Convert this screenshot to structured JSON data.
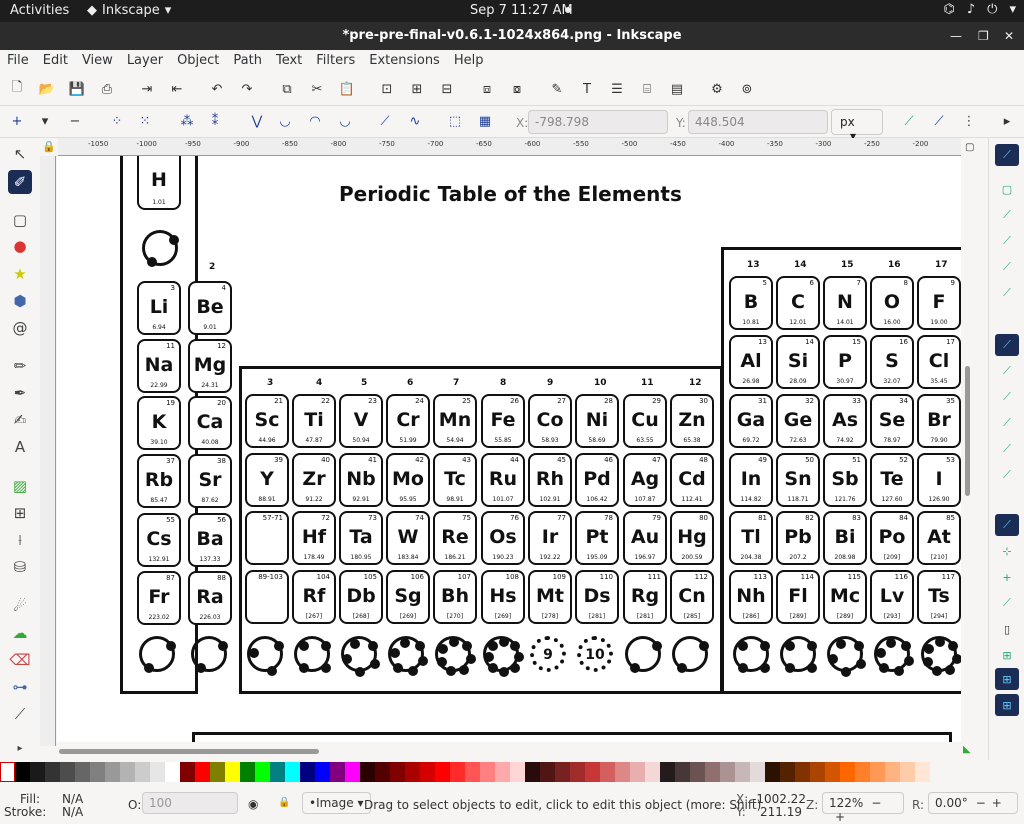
{
  "gnome": {
    "activities": "Activities",
    "app_name": "Inkscape",
    "clock": "Sep 7  11:27 AM"
  },
  "window": {
    "title": "*pre-pre-final-v0.6.1-1024x864.png - Inkscape"
  },
  "menu": [
    "File",
    "Edit",
    "View",
    "Layer",
    "Object",
    "Path",
    "Text",
    "Filters",
    "Extensions",
    "Help"
  ],
  "controls": {
    "x_label": "X:",
    "x_value": "-798.798",
    "y_label": "Y:",
    "y_value": "448.504",
    "unit": "px"
  },
  "ruler_ticks": [
    "-1050",
    "-1000",
    "-950",
    "-900",
    "-850",
    "-800",
    "-750",
    "-700",
    "-650",
    "-600",
    "-550",
    "-500",
    "-450",
    "-400",
    "-350",
    "-300",
    "-250",
    "-200"
  ],
  "canvas": {
    "title": "Periodic Table of the Elements",
    "group_numbers": [
      "2",
      "3",
      "4",
      "5",
      "6",
      "7",
      "8",
      "9",
      "10",
      "11",
      "12",
      "13",
      "14",
      "15",
      "16",
      "17"
    ],
    "ring_labels": [
      "9",
      "10"
    ],
    "elements": [
      {
        "s": "H",
        "n": "",
        "m": "1.01"
      },
      {
        "s": "Li",
        "n": "3",
        "m": "6.94"
      },
      {
        "s": "Be",
        "n": "4",
        "m": "9.01"
      },
      {
        "s": "Na",
        "n": "11",
        "m": "22.99"
      },
      {
        "s": "Mg",
        "n": "12",
        "m": "24.31"
      },
      {
        "s": "K",
        "n": "19",
        "m": "39.10"
      },
      {
        "s": "Ca",
        "n": "20",
        "m": "40.08"
      },
      {
        "s": "Rb",
        "n": "37",
        "m": "85.47"
      },
      {
        "s": "Sr",
        "n": "38",
        "m": "87.62"
      },
      {
        "s": "Cs",
        "n": "55",
        "m": "132.91"
      },
      {
        "s": "Ba",
        "n": "56",
        "m": "137.33"
      },
      {
        "s": "Fr",
        "n": "87",
        "m": "223.02"
      },
      {
        "s": "Ra",
        "n": "88",
        "m": "226.03"
      },
      {
        "s": "Sc",
        "n": "21",
        "m": "44.96"
      },
      {
        "s": "Ti",
        "n": "22",
        "m": "47.87"
      },
      {
        "s": "V",
        "n": "23",
        "m": "50.94"
      },
      {
        "s": "Cr",
        "n": "24",
        "m": "51.99"
      },
      {
        "s": "Mn",
        "n": "25",
        "m": "54.94"
      },
      {
        "s": "Fe",
        "n": "26",
        "m": "55.85"
      },
      {
        "s": "Co",
        "n": "27",
        "m": "58.93"
      },
      {
        "s": "Ni",
        "n": "28",
        "m": "58.69"
      },
      {
        "s": "Cu",
        "n": "29",
        "m": "63.55"
      },
      {
        "s": "Zn",
        "n": "30",
        "m": "65.38"
      },
      {
        "s": "Y",
        "n": "39",
        "m": "88.91"
      },
      {
        "s": "Zr",
        "n": "40",
        "m": "91.22"
      },
      {
        "s": "Nb",
        "n": "41",
        "m": "92.91"
      },
      {
        "s": "Mo",
        "n": "42",
        "m": "95.95"
      },
      {
        "s": "Tc",
        "n": "43",
        "m": "98.91"
      },
      {
        "s": "Ru",
        "n": "44",
        "m": "101.07"
      },
      {
        "s": "Rh",
        "n": "45",
        "m": "102.91"
      },
      {
        "s": "Pd",
        "n": "46",
        "m": "106.42"
      },
      {
        "s": "Ag",
        "n": "47",
        "m": "107.87"
      },
      {
        "s": "Cd",
        "n": "48",
        "m": "112.41"
      },
      {
        "s": "",
        "n": "57-71",
        "m": ""
      },
      {
        "s": "Hf",
        "n": "72",
        "m": "178.49"
      },
      {
        "s": "Ta",
        "n": "73",
        "m": "180.95"
      },
      {
        "s": "W",
        "n": "74",
        "m": "183.84"
      },
      {
        "s": "Re",
        "n": "75",
        "m": "186.21"
      },
      {
        "s": "Os",
        "n": "76",
        "m": "190.23"
      },
      {
        "s": "Ir",
        "n": "77",
        "m": "192.22"
      },
      {
        "s": "Pt",
        "n": "78",
        "m": "195.09"
      },
      {
        "s": "Au",
        "n": "79",
        "m": "196.97"
      },
      {
        "s": "Hg",
        "n": "80",
        "m": "200.59"
      },
      {
        "s": "",
        "n": "89-103",
        "m": ""
      },
      {
        "s": "Rf",
        "n": "104",
        "m": "[267]"
      },
      {
        "s": "Db",
        "n": "105",
        "m": "[268]"
      },
      {
        "s": "Sg",
        "n": "106",
        "m": "[269]"
      },
      {
        "s": "Bh",
        "n": "107",
        "m": "[270]"
      },
      {
        "s": "Hs",
        "n": "108",
        "m": "[269]"
      },
      {
        "s": "Mt",
        "n": "109",
        "m": "[278]"
      },
      {
        "s": "Ds",
        "n": "110",
        "m": "[281]"
      },
      {
        "s": "Rg",
        "n": "111",
        "m": "[281]"
      },
      {
        "s": "Cn",
        "n": "112",
        "m": "[285]"
      },
      {
        "s": "B",
        "n": "5",
        "m": "10.81"
      },
      {
        "s": "C",
        "n": "6",
        "m": "12.01"
      },
      {
        "s": "N",
        "n": "7",
        "m": "14.01"
      },
      {
        "s": "O",
        "n": "8",
        "m": "16.00"
      },
      {
        "s": "F",
        "n": "9",
        "m": "19.00"
      },
      {
        "s": "Al",
        "n": "13",
        "m": "26.98"
      },
      {
        "s": "Si",
        "n": "14",
        "m": "28.09"
      },
      {
        "s": "P",
        "n": "15",
        "m": "30.97"
      },
      {
        "s": "S",
        "n": "16",
        "m": "32.07"
      },
      {
        "s": "Cl",
        "n": "17",
        "m": "35.45"
      },
      {
        "s": "Ga",
        "n": "31",
        "m": "69.72"
      },
      {
        "s": "Ge",
        "n": "32",
        "m": "72.63"
      },
      {
        "s": "As",
        "n": "33",
        "m": "74.92"
      },
      {
        "s": "Se",
        "n": "34",
        "m": "78.97"
      },
      {
        "s": "Br",
        "n": "35",
        "m": "79.90"
      },
      {
        "s": "In",
        "n": "49",
        "m": "114.82"
      },
      {
        "s": "Sn",
        "n": "50",
        "m": "118.71"
      },
      {
        "s": "Sb",
        "n": "51",
        "m": "121.76"
      },
      {
        "s": "Te",
        "n": "52",
        "m": "127.60"
      },
      {
        "s": "I",
        "n": "53",
        "m": "126.90"
      },
      {
        "s": "Tl",
        "n": "81",
        "m": "204.38"
      },
      {
        "s": "Pb",
        "n": "82",
        "m": "207.2"
      },
      {
        "s": "Bi",
        "n": "83",
        "m": "208.98"
      },
      {
        "s": "Po",
        "n": "84",
        "m": "[209]"
      },
      {
        "s": "At",
        "n": "85",
        "m": "[210]"
      },
      {
        "s": "Nh",
        "n": "113",
        "m": "[286]"
      },
      {
        "s": "Fl",
        "n": "114",
        "m": "[289]"
      },
      {
        "s": "Mc",
        "n": "115",
        "m": "[289]"
      },
      {
        "s": "Lv",
        "n": "116",
        "m": "[293]"
      },
      {
        "s": "Ts",
        "n": "117",
        "m": "[294]"
      }
    ]
  },
  "palette": [
    "#000000",
    "#1a1a1a",
    "#333333",
    "#4d4d4d",
    "#666666",
    "#808080",
    "#999999",
    "#b3b3b3",
    "#cccccc",
    "#e6e6e6",
    "#ffffff",
    "#800000",
    "#ff0000",
    "#808000",
    "#ffff00",
    "#008000",
    "#00ff00",
    "#008080",
    "#00ffff",
    "#000080",
    "#0000ff",
    "#800080",
    "#ff00ff",
    "#2b0000",
    "#550000",
    "#800000",
    "#aa0000",
    "#d40000",
    "#ff0000",
    "#ff2a2a",
    "#ff5555",
    "#ff8080",
    "#ffaaaa",
    "#ffd5d5",
    "#280b0b",
    "#501616",
    "#782121",
    "#a02c2c",
    "#c83737",
    "#d35f5f",
    "#de8787",
    "#e9afaf",
    "#f4d7d7",
    "#241c1c",
    "#483737",
    "#6c5353",
    "#916f6f",
    "#ac9393",
    "#c8b7b7",
    "#e3dbdb",
    "#2b1100",
    "#552200",
    "#803300",
    "#aa4400",
    "#d45500",
    "#ff6600",
    "#ff7f2a",
    "#ff9955",
    "#ffb380",
    "#ffccaa",
    "#ffe6d5"
  ],
  "status": {
    "fill_label": "Fill:",
    "fill_value": "N/A",
    "stroke_label": "Stroke:",
    "stroke_value": "N/A",
    "opacity_label": "O:",
    "opacity_value": "100",
    "layer": "•Image",
    "message": "Drag to select objects to edit, click to edit this object (more: Shift)",
    "cx_label": "X:",
    "cx": "-1002.22",
    "cy_label": "Y:",
    "cy": "211.19",
    "zoom_label": "Z:",
    "zoom": "122%",
    "rot_label": "R:",
    "rotation": "0.00°"
  }
}
